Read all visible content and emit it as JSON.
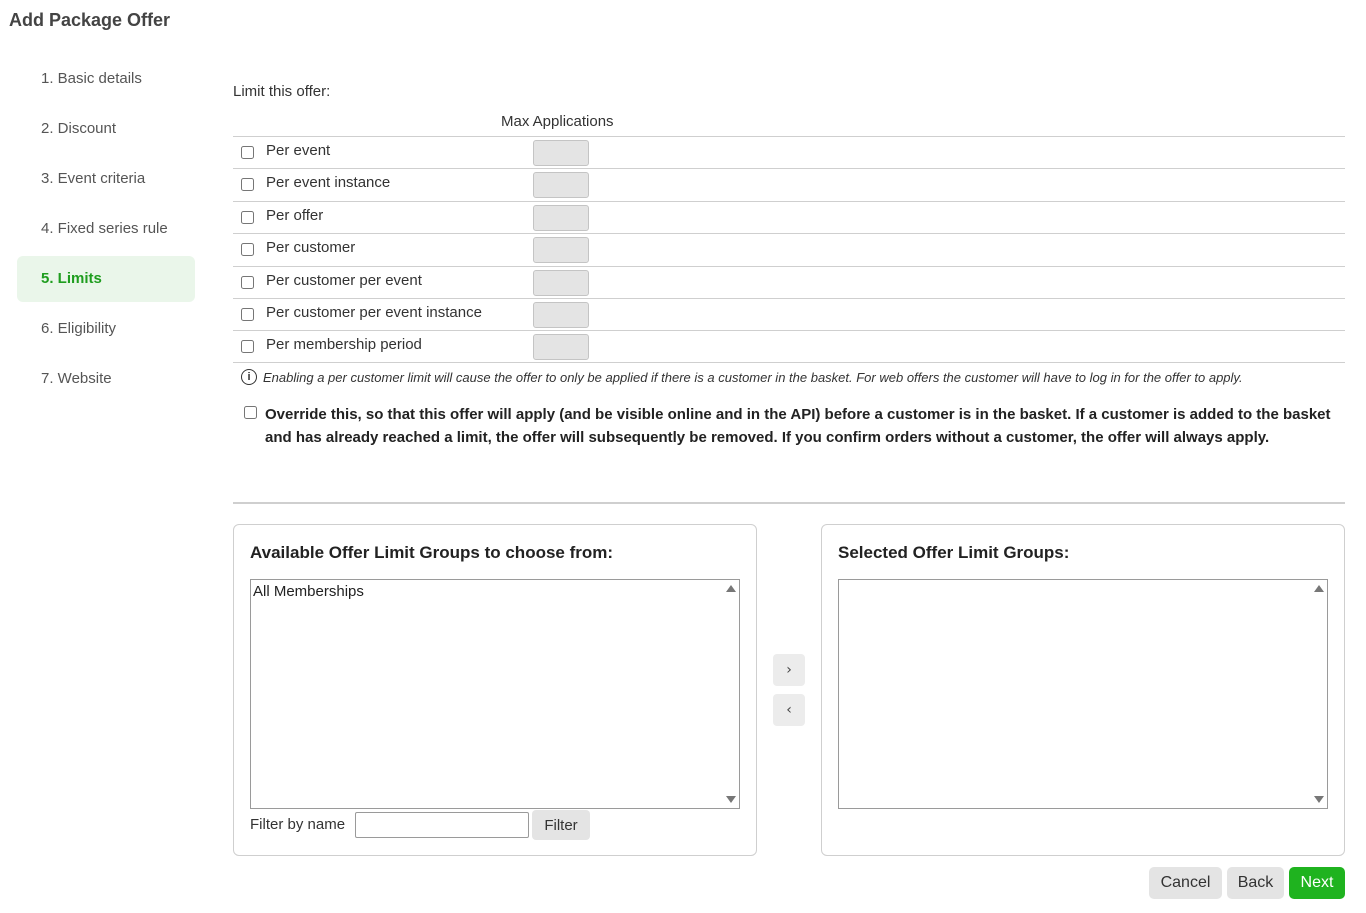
{
  "page": {
    "title": "Add Package Offer"
  },
  "sidebar": {
    "steps": [
      {
        "label": "1. Basic details"
      },
      {
        "label": "2. Discount"
      },
      {
        "label": "3. Event criteria"
      },
      {
        "label": "4. Fixed series rule"
      },
      {
        "label": "5. Limits",
        "active": true
      },
      {
        "label": "6. Eligibility"
      },
      {
        "label": "7. Website"
      }
    ]
  },
  "limits": {
    "title": "Limit this offer:",
    "column_header": "Max Applications",
    "rows": [
      {
        "label": "Per event",
        "checked": false,
        "value": ""
      },
      {
        "label": "Per event instance",
        "checked": false,
        "value": ""
      },
      {
        "label": "Per offer",
        "checked": false,
        "value": ""
      },
      {
        "label": "Per customer",
        "checked": false,
        "value": ""
      },
      {
        "label": "Per customer per event",
        "checked": false,
        "value": ""
      },
      {
        "label": "Per customer per event instance",
        "checked": false,
        "value": ""
      },
      {
        "label": "Per membership period",
        "checked": false,
        "value": ""
      }
    ],
    "info_text": "Enabling a per customer limit will cause the offer to only be applied if there is a customer in the basket. For web offers the customer will have to log in for the offer to apply.",
    "override_text": "Override this, so that this offer will apply (and be visible online and in the API) before a customer is in the basket. If a customer is added to the basket and has already reached a limit, the offer will subsequently be removed. If you confirm orders without a customer, the offer will always apply.",
    "override_checked": false
  },
  "groups": {
    "available_title": "Available Offer Limit Groups to choose from:",
    "available_items": [
      "All Memberships"
    ],
    "selected_title": "Selected Offer Limit Groups:",
    "selected_items": [],
    "filter_label": "Filter by name",
    "filter_value": "",
    "filter_button": "Filter",
    "move_right": "›",
    "move_left": "‹"
  },
  "footer": {
    "cancel": "Cancel",
    "back": "Back",
    "next": "Next",
    "accent_color": "#1fb31f"
  }
}
